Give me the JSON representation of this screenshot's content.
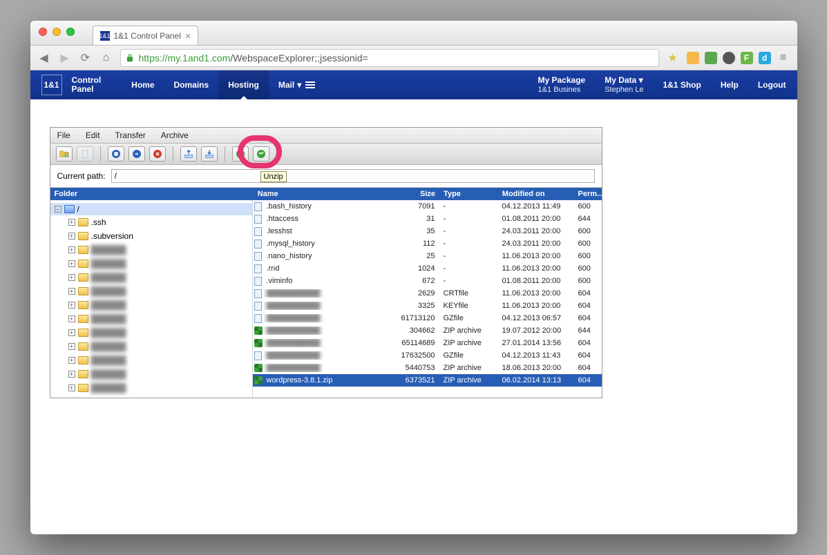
{
  "browser": {
    "tab_title": "1&1 Control Panel",
    "url_prefix": "https",
    "url_host": "://my.1and1.com",
    "url_path": "/WebspaceExplorer;;jsessionid="
  },
  "header": {
    "logo": "1&1",
    "brand_line1": "Control",
    "brand_line2": "Panel",
    "nav": {
      "home": "Home",
      "domains": "Domains",
      "hosting": "Hosting",
      "mail": "Mail"
    },
    "package": {
      "label": "My Package",
      "value": "1&1 Busines"
    },
    "data_label": "My Data",
    "data_value": "Stephen Le",
    "shop": "1&1 Shop",
    "help": "Help",
    "logout": "Logout"
  },
  "explorer": {
    "menu": {
      "file": "File",
      "edit": "Edit",
      "transfer": "Transfer",
      "archive": "Archive"
    },
    "tooltip": "Unzip",
    "path_label": "Current path:",
    "path_value": "/",
    "cols": {
      "folder": "Folder",
      "name": "Name",
      "size": "Size",
      "type": "Type",
      "modified": "Modified on",
      "perm": "Perm..."
    },
    "root": "/",
    "tree": [
      {
        "name": ".ssh",
        "blur": false
      },
      {
        "name": ".subversion",
        "blur": false
      },
      {
        "name": "redacted-a",
        "blur": true
      },
      {
        "name": "redacted-b",
        "blur": true
      },
      {
        "name": "redacted-c",
        "blur": true
      },
      {
        "name": "redacted-d",
        "blur": true
      },
      {
        "name": "redacted-e",
        "blur": true
      },
      {
        "name": "redacted-f",
        "blur": true
      },
      {
        "name": "redacted-g",
        "blur": true
      },
      {
        "name": "redacted-h",
        "blur": true
      },
      {
        "name": "redacted-i",
        "blur": true
      },
      {
        "name": "redacted-j",
        "blur": true
      },
      {
        "name": "redacted-k",
        "blur": true
      }
    ],
    "files": [
      {
        "icon": "page",
        "name": ".bash_history",
        "size": "7091",
        "type": "-",
        "mod": "04.12.2013 11:49",
        "perm": "600"
      },
      {
        "icon": "page",
        "name": ".htaccess",
        "size": "31",
        "type": "-",
        "mod": "01.08.2011 20:00",
        "perm": "644"
      },
      {
        "icon": "page",
        "name": ".lesshst",
        "size": "35",
        "type": "-",
        "mod": "24.03.2011 20:00",
        "perm": "600"
      },
      {
        "icon": "page",
        "name": ".mysql_history",
        "size": "112",
        "type": "-",
        "mod": "24.03.2011 20:00",
        "perm": "600"
      },
      {
        "icon": "page",
        "name": ".nano_history",
        "size": "25",
        "type": "-",
        "mod": "11.06.2013 20:00",
        "perm": "600"
      },
      {
        "icon": "page",
        "name": ".rnd",
        "size": "1024",
        "type": "-",
        "mod": "11.06.2013 20:00",
        "perm": "600"
      },
      {
        "icon": "page",
        "name": ".viminfo",
        "size": "672",
        "type": "-",
        "mod": "01.08.2011 20:00",
        "perm": "600"
      },
      {
        "icon": "page",
        "name": "",
        "blur": true,
        "size": "2629",
        "type": "CRTfile",
        "mod": "11.06.2013 20:00",
        "perm": "604"
      },
      {
        "icon": "page",
        "name": "",
        "blur": true,
        "size": "3325",
        "type": "KEYfile",
        "mod": "11.06.2013 20:00",
        "perm": "604"
      },
      {
        "icon": "page",
        "name": "",
        "blur": true,
        "size": "61713120",
        "type": "GZfile",
        "mod": "04.12.2013 06:57",
        "perm": "604"
      },
      {
        "icon": "zip",
        "name": "",
        "blur": true,
        "size": "304662",
        "type": "ZIP archive",
        "mod": "19.07.2012 20:00",
        "perm": "644"
      },
      {
        "icon": "zip",
        "name": "",
        "blur": true,
        "size": "65114689",
        "type": "ZIP archive",
        "mod": "27.01.2014 13:56",
        "perm": "604"
      },
      {
        "icon": "page",
        "name": "",
        "blur": true,
        "size": "17632500",
        "type": "GZfile",
        "mod": "04.12.2013 11:43",
        "perm": "604"
      },
      {
        "icon": "zip",
        "name": "",
        "blur": true,
        "size": "5440753",
        "type": "ZIP archive",
        "mod": "18.06.2013 20:00",
        "perm": "604"
      },
      {
        "icon": "zip",
        "name": "wordpress-3.8.1.zip",
        "size": "6373521",
        "type": "ZIP archive",
        "mod": "06.02.2014 13:13",
        "perm": "604",
        "selected": true
      }
    ]
  }
}
